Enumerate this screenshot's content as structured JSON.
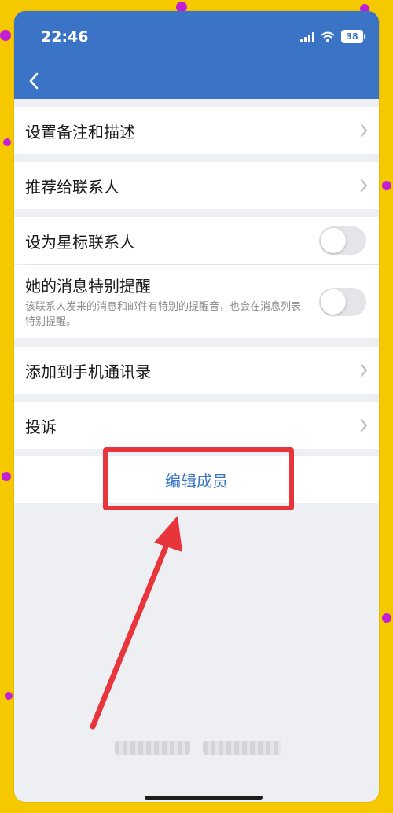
{
  "status_bar": {
    "time": "22:46",
    "battery": "38"
  },
  "nav": {
    "back_icon": "chevron-left-icon"
  },
  "menu": {
    "set_remark": "设置备注和描述",
    "recommend": "推荐给联系人",
    "star_contact": "设为星标联系人",
    "special_alert": "她的消息特别提醒",
    "special_alert_desc": "该联系人发来的消息和邮件有特别的提醒音，也会在消息列表特别提醒。",
    "add_to_phone": "添加到手机通讯录",
    "complain": "投诉"
  },
  "toggles": {
    "star_contact": false,
    "special_alert": false
  },
  "action": {
    "edit_member": "编辑成员"
  },
  "colors": {
    "header": "#3b74c6",
    "accent_link": "#3b74c6",
    "annotation": "#e8343b",
    "background_frame": "#f6c800"
  }
}
